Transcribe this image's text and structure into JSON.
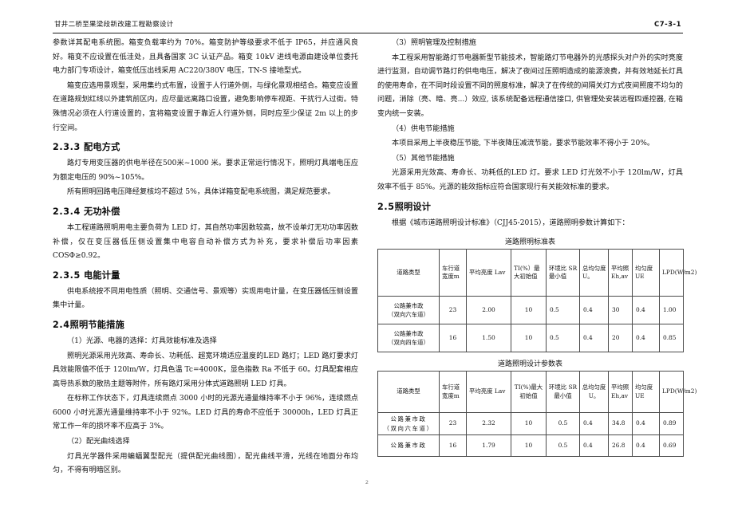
{
  "header": {
    "title": "甘井二桥至果梁段新改建工程勘察设计",
    "code": "C7-3-1"
  },
  "page_number": "2",
  "left_column": {
    "para_1": "参数详其配电系统图。箱变负载率约为 70%。箱变防护等级要求不低于 IP65，并应通风良好。箱变不应设置在低洼处，且具备国家 3C 认证产品。箱变 10kV 进线电源由建设单位委托电力部门专项设计，箱变低压出线采用 AC220/380V 电压，TN-S 接地型式。",
    "para_2": "箱变应选用景观型，采用集约式布置，设置于人行道外侧，与绿化景观相结合。箱变应设置在道路规划红线以外建筑前区内，应尽量远离路口设置，避免影响停车视距、干扰行人过街。特殊情况必须在人行道设置的，宜将箱变设置于靠近人行道外侧，同时应至少保证 2m 以上的步行空间。",
    "heading_233_num": "2.3.3",
    "heading_233_text": "配电方式",
    "para_3": "路灯专用变压器的供电半径在500米~1000 米。要求正常运行情况下，照明灯具端电压应为额定电压的 90%~105%。",
    "para_4": "所有照明回路电压降经复核均不超过 5%，具体详箱变配电系统图，满足规范要求。",
    "heading_234_num": "2.3.4",
    "heading_234_text": "无功补偿",
    "para_5": "本工程道路照明用电主要负荷为 LED 灯，其自然功率因数较高，故不设单灯无功功率因数补偿，仅在变压器低压侧设置集中电容自动补偿方式为补充，要求补偿后功率因素 COSΦ≥0.92。",
    "heading_235_num": "2.3.5",
    "heading_235_text": "电能计量",
    "para_6": "供电系统按不同用电性质（照明、交通信号、景观等）实现用电计量，在变压器低压侧设置集中计量。",
    "heading_24_num": "2.4",
    "heading_24_text": "照明节能措施",
    "item_1": "（1）光源、电器的选择：灯具效能标准及选择",
    "para_7": "照明光源采用光效高、寿命长、功耗低、超宽环境适应温度的LED 路灯；LED 路灯要求灯具效能限值不低于 120lm/W，灯具色温 Tc=4000K，显色指数 Ra 不低于 60。灯具配套相应高导热系数的散热主题等附件，所有路灯采用分体式道路照明 LED 灯具。",
    "para_8": "在标称工作状态下，灯具连续燃点 3000 小时的光源光通量维持率不小于 96%，连续燃点6000 小时光源光通量维持率不小于 92%。LED 灯具的寿命不应低于 30000h，LED 灯具正常工作一年的损坏率不应高于 3%。",
    "item_2": "（2）配光曲线选择",
    "para_9": "灯具光学器件采用蝙蝠翼型配光（提供配光曲线图），配光曲线平滑，光线在地面分布均匀，不得有明暗区别。"
  },
  "right_column": {
    "item_3": "（3）照明管理及控制措施",
    "para_1": "本工程采用智能路灯节电器新型节能技术，智能路灯节电器外的光感探头对户外的实时亮度进行监测，自动调节路灯的供电电压，解决了夜间过压照明造成的能源浪费，并有效地延长灯具的使用寿命，在不同时段设置不同的照度标准，解决了在传统的间隔关灯方式夜间照度不均匀的问题，消除（亮、暗、亮...）效应, 该系统配备远程通信接口, 供管理处安装远程四遥控器, 在箱变内统一安装。",
    "item_4": "（4）供电节能措施",
    "para_2": "本项目采用上半夜稳压节能, 下半夜降压减流节能，要求节能效率不得小于 20%。",
    "item_5": "（5）其他节能措施",
    "para_3": "光源采用光效高、寿命长、功耗低的LED 灯。要求 LED 灯光效不小于 120lm/W，灯具效率不低于 85%。光源的能效指标应符合国家现行有关能效标准的要求。",
    "heading_25_num": "2.5",
    "heading_25_text": "照明设计",
    "para_4": "根据《城市道路照明设计标准》（CJJ45-2015），道路照明参数计算如下：",
    "table_1": {
      "caption": "道路照明标准表",
      "headers": [
        "道路类型",
        "车行道宽度m",
        "平均亮度 Lav",
        "TI(%）最大初始值",
        "环境比 SR 最小值",
        "总均匀度U。",
        "平均照Eh,av",
        "均匀度UE",
        "LPD(W/m2)"
      ],
      "rows": [
        {
          "type_line1": "公路兼市政",
          "type_line2": "（双向六车道）",
          "values": [
            "23",
            "2.00",
            "10",
            "0.5",
            "0.4",
            "30",
            "0.4",
            "1.00"
          ]
        },
        {
          "type_line1": "公路兼市政",
          "type_line2": "（双向四车道）",
          "values": [
            "16",
            "1.50",
            "10",
            "0.5",
            "0.4",
            "20",
            "0.4",
            "0.85"
          ]
        }
      ]
    },
    "table_2": {
      "caption": "道路照明设计参数表",
      "headers": [
        "道路类型",
        "车行道宽度m",
        "平均亮度 Lav",
        "TI(%)最大初始值",
        "环境比 SR 最小值",
        "总均匀度U。",
        "平均照Eh,av",
        "均匀度UE",
        "LPD(W/m2)"
      ],
      "rows": [
        {
          "type_line1": "公路兼市政",
          "type_line2": "（双向六车道）",
          "values": [
            "23",
            "2.32",
            "10",
            "0.5",
            "0.4",
            "34.8",
            "0.4",
            "0.89"
          ]
        },
        {
          "type_line1": "公路兼市政",
          "type_line2": "",
          "values": [
            "16",
            "1.79",
            "10",
            "0.5",
            "0.4",
            "26.8",
            "0.4",
            "0.69"
          ]
        }
      ]
    }
  }
}
